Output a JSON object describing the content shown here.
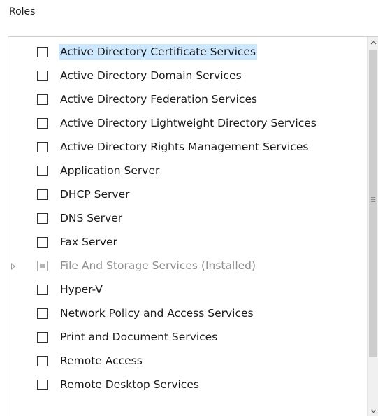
{
  "section": {
    "title": "Roles"
  },
  "roles": [
    {
      "label": "Active Directory Certificate Services",
      "checked": false,
      "selected": true,
      "disabled": false,
      "expandable": false
    },
    {
      "label": "Active Directory Domain Services",
      "checked": false,
      "selected": false,
      "disabled": false,
      "expandable": false
    },
    {
      "label": "Active Directory Federation Services",
      "checked": false,
      "selected": false,
      "disabled": false,
      "expandable": false
    },
    {
      "label": "Active Directory Lightweight Directory Services",
      "checked": false,
      "selected": false,
      "disabled": false,
      "expandable": false
    },
    {
      "label": "Active Directory Rights Management Services",
      "checked": false,
      "selected": false,
      "disabled": false,
      "expandable": false
    },
    {
      "label": "Application Server",
      "checked": false,
      "selected": false,
      "disabled": false,
      "expandable": false
    },
    {
      "label": "DHCP Server",
      "checked": false,
      "selected": false,
      "disabled": false,
      "expandable": false
    },
    {
      "label": "DNS Server",
      "checked": false,
      "selected": false,
      "disabled": false,
      "expandable": false
    },
    {
      "label": "Fax Server",
      "checked": false,
      "selected": false,
      "disabled": false,
      "expandable": false
    },
    {
      "label": "File And Storage Services (Installed)",
      "checked": "partial",
      "selected": false,
      "disabled": true,
      "expandable": true
    },
    {
      "label": "Hyper-V",
      "checked": false,
      "selected": false,
      "disabled": false,
      "expandable": false
    },
    {
      "label": "Network Policy and Access Services",
      "checked": false,
      "selected": false,
      "disabled": false,
      "expandable": false
    },
    {
      "label": "Print and Document Services",
      "checked": false,
      "selected": false,
      "disabled": false,
      "expandable": false
    },
    {
      "label": "Remote Access",
      "checked": false,
      "selected": false,
      "disabled": false,
      "expandable": false
    },
    {
      "label": "Remote Desktop Services",
      "checked": false,
      "selected": false,
      "disabled": false,
      "expandable": false
    }
  ],
  "scrollbar": {
    "up_icon": "chevron-up-icon",
    "down_icon": "chevron-down-icon",
    "grip_icon": "grip-lines-icon"
  },
  "colors": {
    "selection": "#cce8ff",
    "selection_band": "#e5f3ff",
    "text": "#1a1a1a",
    "disabled_text": "#8e8e8e"
  }
}
